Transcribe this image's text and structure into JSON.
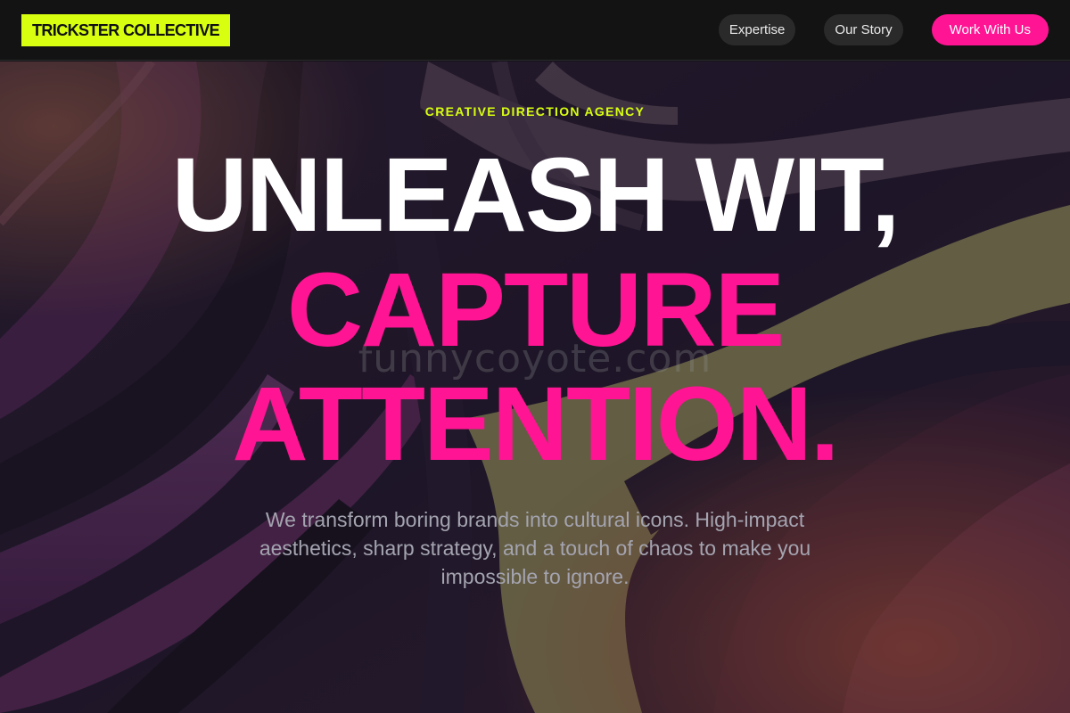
{
  "navbar": {
    "logo_text": "TRICKSTER COLLECTIVE",
    "links": [
      {
        "label": "Expertise"
      },
      {
        "label": "Our Story"
      }
    ],
    "cta_label": "Work With Us"
  },
  "hero": {
    "eyebrow": "CREATIVE DIRECTION AGENCY",
    "headline_line1": "UNLEASH WIT,",
    "headline_line2": "CAPTURE",
    "headline_line3": "ATTENTION.",
    "subtext": "We transform boring brands into cultural icons. High-impact aesthetics, sharp strategy, and a touch of chaos to make you impossible to ignore.",
    "watermark": "funnycoyote.com"
  },
  "colors": {
    "accent_lime": "#d8ff0f",
    "accent_pink": "#ff1493",
    "nav_bg": "#131313",
    "pill_bg": "#2a2a2a",
    "subtext": "#a4a4b0",
    "hero_purple": "#3a2545",
    "hero_magenta": "#5a2756",
    "hero_olive": "#8c8658"
  }
}
